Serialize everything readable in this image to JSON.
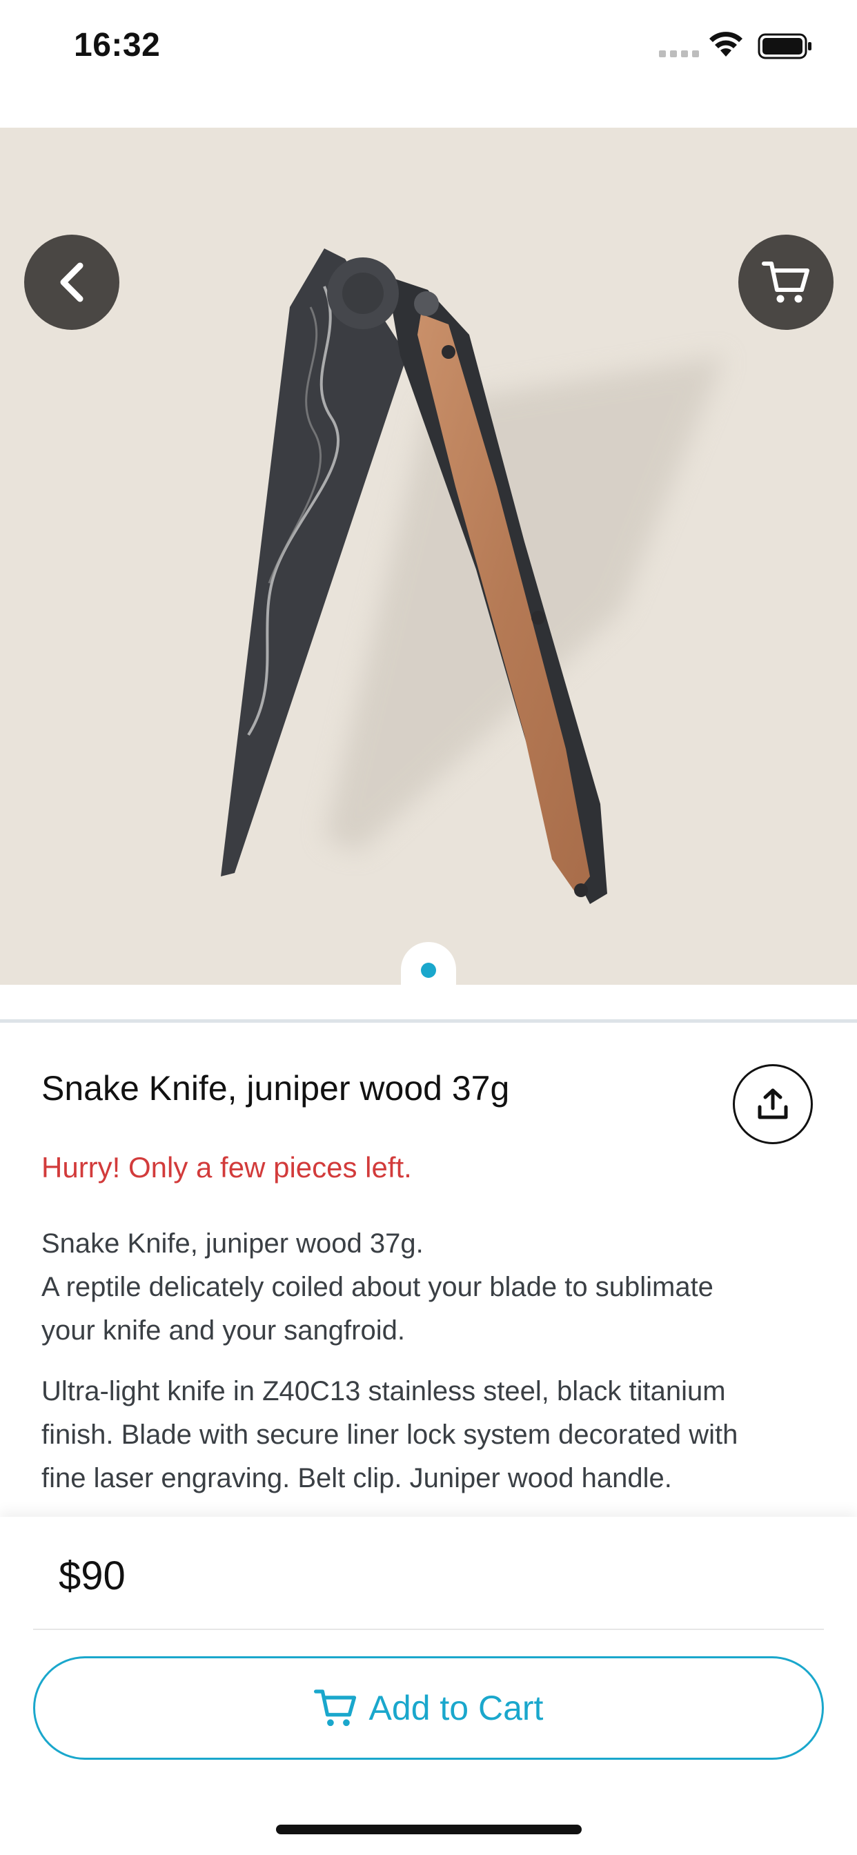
{
  "status_bar": {
    "time": "16:32"
  },
  "product": {
    "title": "Snake Knife, juniper wood 37g",
    "urgency": "Hurry! Only a few pieces left.",
    "description_1": [
      "Snake Knife, juniper wood 37g.",
      "A reptile delicately coiled about your blade to sublimate",
      "your knife and your sangfroid."
    ],
    "description_2": [
      "Ultra-light knife in Z40C13 stainless steel, black titanium",
      "finish. Blade with secure liner lock system decorated with",
      "fine laser engraving. Belt clip. Juniper wood handle."
    ],
    "price": "$90"
  },
  "carousel": {
    "page_count": 1,
    "current_page": 1
  },
  "actions": {
    "add_to_cart_label": "Add to Cart"
  },
  "colors": {
    "accent": "#1aa7cc",
    "urgency": "#d23b3b",
    "hero_bg": "#e9e3da",
    "nav_button_bg": "#4a4744"
  },
  "icons": {
    "back": "chevron-left-icon",
    "cart": "cart-icon",
    "share": "share-icon",
    "add_to_cart": "cart-icon"
  }
}
